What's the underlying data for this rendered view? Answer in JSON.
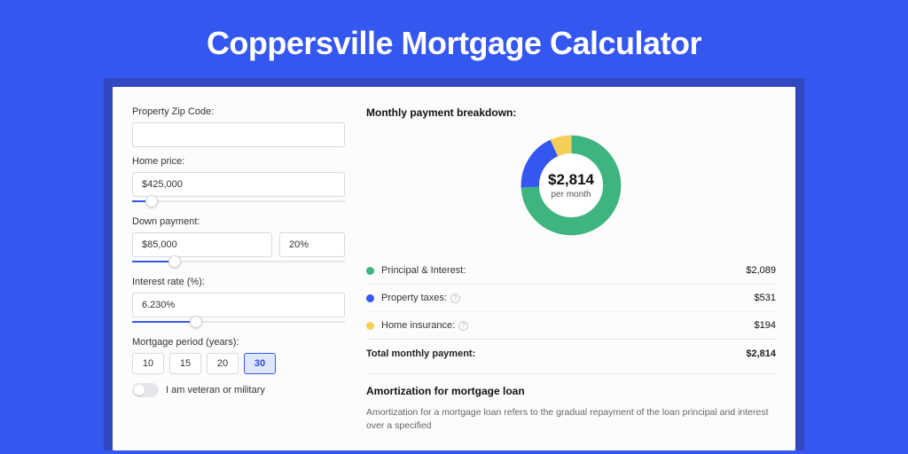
{
  "title": "Coppersville Mortgage Calculator",
  "form": {
    "zip_label": "Property Zip Code:",
    "zip_value": "",
    "home_price_label": "Home price:",
    "home_price_value": "$425,000",
    "home_price_slider_pct": 9,
    "down_label": "Down payment:",
    "down_value": "$85,000",
    "down_pct_value": "20%",
    "down_slider_pct": 20,
    "rate_label": "Interest rate (%):",
    "rate_value": "6.230%",
    "rate_slider_pct": 30,
    "period_label": "Mortgage period (years):",
    "period_options": [
      "10",
      "15",
      "20",
      "30"
    ],
    "period_selected": "30",
    "veteran_label": "I am veteran or military",
    "veteran_on": false
  },
  "breakdown": {
    "heading": "Monthly payment breakdown:",
    "center_amount": "$2,814",
    "center_sub": "per month",
    "items": [
      {
        "key": "pi",
        "label": "Principal & Interest:",
        "value": "$2,089",
        "color": "green",
        "help": false,
        "share": 0.742
      },
      {
        "key": "tax",
        "label": "Property taxes:",
        "value": "$531",
        "color": "blue",
        "help": true,
        "share": 0.189
      },
      {
        "key": "ins",
        "label": "Home insurance:",
        "value": "$194",
        "color": "yellow",
        "help": true,
        "share": 0.069
      }
    ],
    "total_label": "Total monthly payment:",
    "total_value": "$2,814"
  },
  "amortization": {
    "heading": "Amortization for mortgage loan",
    "text": "Amortization for a mortgage loan refers to the gradual repayment of the loan principal and interest over a specified"
  },
  "chart_data": {
    "type": "pie",
    "title": "Monthly payment breakdown",
    "series": [
      {
        "name": "Principal & Interest",
        "value": 2089,
        "color": "#3eb57f"
      },
      {
        "name": "Property taxes",
        "value": 531,
        "color": "#3457f0"
      },
      {
        "name": "Home insurance",
        "value": 194,
        "color": "#f3cf5a"
      }
    ],
    "total": 2814,
    "center_label": "$2,814 per month",
    "donut_inner_ratio": 0.62
  }
}
